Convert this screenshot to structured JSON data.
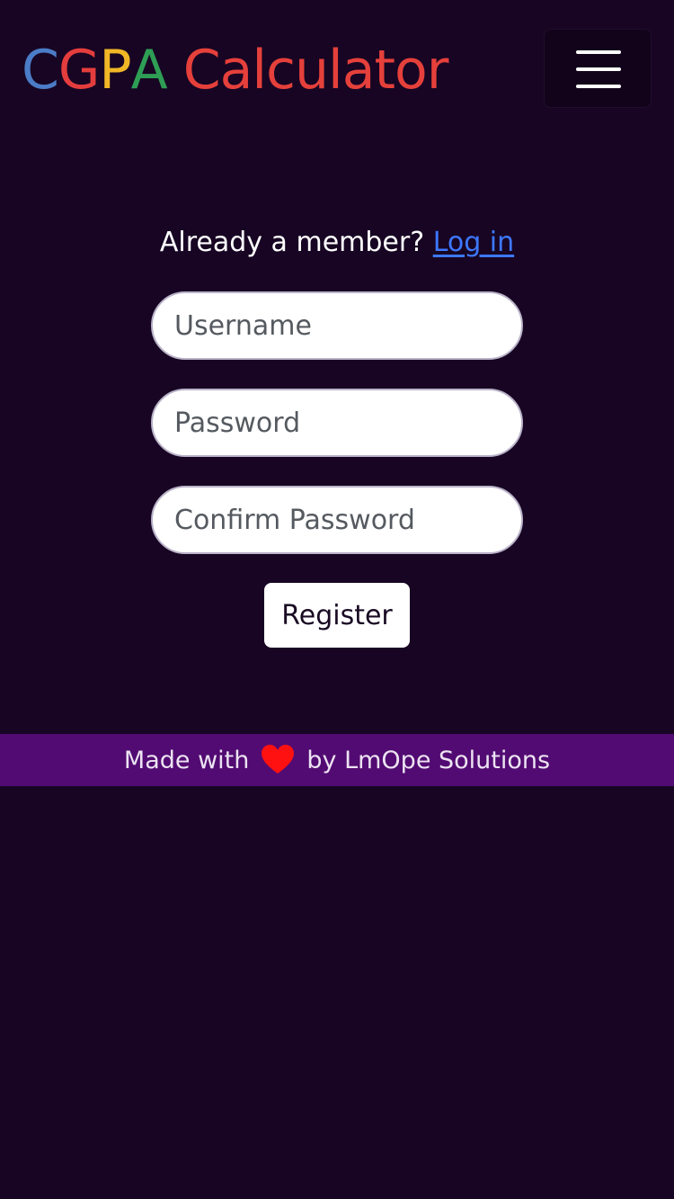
{
  "header": {
    "brand_letters": [
      {
        "char": "C",
        "color": "#4b7cc7"
      },
      {
        "char": "G",
        "color": "#e43d3d"
      },
      {
        "char": "P",
        "color": "#f0b626"
      },
      {
        "char": "A",
        "color": "#2e9e55"
      }
    ],
    "brand_rest": " Calculator",
    "brand_rest_color": "#e5403b",
    "menu_icon": "hamburger-menu-icon"
  },
  "auth": {
    "prompt": "Already a member?",
    "login_link": "Log in",
    "link_color": "#3d78ff",
    "fields": {
      "username_placeholder": "Username",
      "password_placeholder": "Password",
      "confirm_placeholder": "Confirm Password"
    },
    "register_label": "Register"
  },
  "footer": {
    "made_with": "Made with",
    "heart_icon": "heart-icon",
    "heart_color": "#ff1111",
    "by_text": "by LmOpe Solutions",
    "background": "#520b72"
  },
  "theme": {
    "background": "#170523"
  }
}
